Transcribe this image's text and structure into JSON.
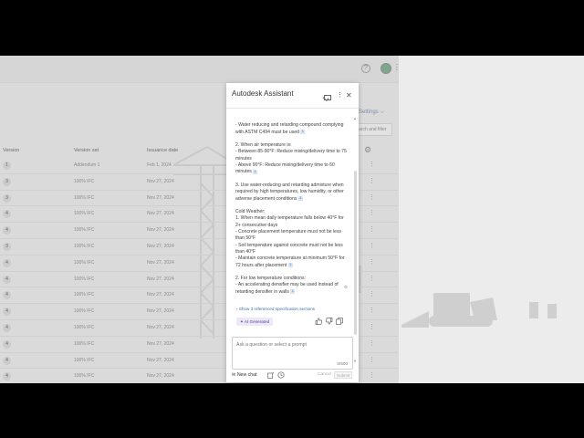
{
  "background": {
    "settings_label": "Settings",
    "search_filter_label": "Search and filter",
    "columns": [
      "Version",
      "Version set",
      "Issuance date"
    ],
    "rows": [
      {
        "version": "1",
        "version_set": "Addendum 1",
        "date": "Feb 1, 2024"
      },
      {
        "version": "3",
        "version_set": "100% IFC",
        "date": "Nov 27, 2024"
      },
      {
        "version": "3",
        "version_set": "100% IFC",
        "date": "Nov 27, 2024"
      },
      {
        "version": "4",
        "version_set": "100% IFC",
        "date": "Nov 27, 2024"
      },
      {
        "version": "4",
        "version_set": "100% IFC",
        "date": "Nov 27, 2024"
      },
      {
        "version": "3",
        "version_set": "100% IFC",
        "date": "Nov 27, 2024"
      },
      {
        "version": "4",
        "version_set": "100% IFC",
        "date": "Nov 27, 2024"
      },
      {
        "version": "4",
        "version_set": "100% IFC",
        "date": "Nov 27, 2024"
      },
      {
        "version": "4",
        "version_set": "100% IFC",
        "date": "Nov 27, 2024"
      },
      {
        "version": "4",
        "version_set": "100% IFC",
        "date": "Nov 27, 2024"
      },
      {
        "version": "4",
        "version_set": "100% IFC",
        "date": "Nov 27, 2024"
      },
      {
        "version": "4",
        "version_set": "100% IFC",
        "date": "Nov 27, 2024"
      },
      {
        "version": "4",
        "version_set": "100% IFC",
        "date": "Nov 27, 2024"
      },
      {
        "version": "4",
        "version_set": "100% IFC",
        "date": "Nov 27, 2024"
      }
    ]
  },
  "assistant": {
    "title": "Autodesk Assistant",
    "messages": [
      {
        "text": "- Water reducing and retarding compound complying with ASTM C494 must be used",
        "cite": "1"
      },
      {
        "text": "2. When air temperature is:\n- Between 85-90°F: Reduce mixing/delivery time to 75 minutes\n- Above 90°F: Reduce mixing/delivery time to 60 minutes",
        "cite": "1"
      },
      {
        "text": "3. Use water-reducing and retarding admixture when required by high temperatures, low humidity, or other adverse placement conditions",
        "cite": "1"
      },
      {
        "text": "Cold Weather:\n1. When mean daily temperature falls below 40°F for 2+ consecutive days\n- Concrete placement temperature must not be less than 50°F\n- Soil temperature against concrete must not be less than 40°F\n- Maintain concrete temperature at minimum 50°F for 72 hours after placement",
        "cite": "1"
      },
      {
        "text": "2. For low temperature conditions:\n- An accelerating densifier may be used instead of retarding densifier in walls",
        "cite": "1"
      }
    ],
    "refs_label": "Show 3 referenced specification sections",
    "ai_badge": "AI Generated",
    "input_placeholder": "Ask a question or select a prompt",
    "char_counter": "0/500",
    "new_chat_label": "New chat",
    "cancel_label": "Cancel",
    "submit_label": "Submit"
  },
  "icons": {
    "close": "close-icon",
    "more": "more-vertical-icon",
    "mail": "mail-icon",
    "thumbs_up": "thumbs-up-icon",
    "thumbs_down": "thumbs-down-icon",
    "copy": "copy-icon",
    "history": "history-icon",
    "prompts": "prompt-library-icon"
  }
}
